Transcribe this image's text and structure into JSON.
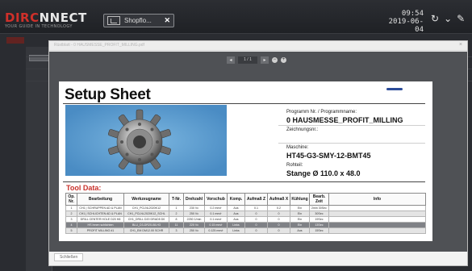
{
  "app": {
    "logo_prefix": "DIRC",
    "logo_suffix": "NNECT",
    "tagline": "YOUR GUIDE IN TECHNOLOGY",
    "tab_label": "Shopflo...",
    "time": "09:54",
    "date": "2019-06-04",
    "icons": [
      "reload-icon",
      "chevron-down-icon",
      "edit-icon"
    ]
  },
  "modal": {
    "title": "Rüstblatt - 0 HAUSMESSE_PROFIT_MILLING.pdf",
    "close": "×",
    "footer_button": "Schließen",
    "viewer": {
      "page_indicator": "1 / 1",
      "prev": "◂",
      "next": "▸",
      "zoom_out": "−",
      "zoom_in": "+"
    }
  },
  "sheet": {
    "title": "Setup Sheet",
    "program_label": "Programm Nr. / Programmname:",
    "program_value": "0 HAUSMESSE_PROFIT_MILLING",
    "drawing_label": "Zeichnungsnr.:",
    "drawing_value": "",
    "machine_label": "Maschine:",
    "machine_value": "HT45-G3-SMY-12-BMT45",
    "raw_label": "Rohteil:",
    "raw_value": "Stange Ø 110.0 x  48.0",
    "tool_data_title": "Tool Data:",
    "columns": [
      "Op. Nr.",
      "Bearbeitung",
      "Werkzeugname",
      "T-Nr.",
      "Drehzahl",
      "Vorschub",
      "Komp.",
      "Aufmaß Z",
      "Aufmaß X",
      "Kühlung",
      "Bearb. Zeit",
      "Info"
    ],
    "rows": [
      [
        "1",
        "CH1 | SCHRUPPEN AD & PLAN",
        "CH1_PCLNL2020K12",
        "1",
        "230 Vc",
        "0.2 mm/r",
        "Aus",
        "0.1",
        "0.2",
        "Ein",
        "2min 30Sec",
        ""
      ],
      [
        "2",
        "CH1 | SCHLICHTEN AD & PLAN",
        "CH1_PCLNL2020K12_SCHL",
        "2",
        "250 Vc",
        "0.1 mm/r",
        "Aus",
        "0",
        "0",
        "Ein",
        "30Sec",
        ""
      ],
      [
        "3",
        "DRILL CENTER HOLE D20 H8",
        "CH1_DRILL D20 DRAD5 D0",
        "8",
        "2250 1/min",
        "0.1 mm/r",
        "Aus",
        "0",
        "0",
        "Ein",
        "19Sec",
        ""
      ],
      [
        "4",
        "HS Innen schlichten",
        "BLU_D3-DR20-08-H3",
        "11",
        "220 Vc",
        "0.15 mm/r",
        "Links",
        "0",
        "0",
        "Ein",
        "13Sec",
        ""
      ],
      [
        "5",
        "PROFIT MILLING #1",
        "CH1_EM DM12.00 SCHR",
        "3",
        "250 Vc",
        "0.125 mm/r",
        "Links",
        "0",
        "0",
        "Aus",
        "15Sec",
        ""
      ]
    ]
  }
}
